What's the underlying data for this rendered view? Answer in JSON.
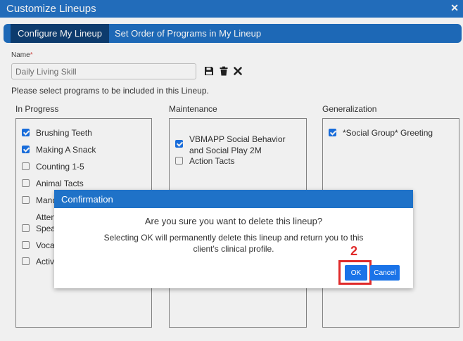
{
  "window": {
    "title": "Customize Lineups",
    "close_glyph": "✕"
  },
  "tabs": [
    {
      "label": "Configure My Lineup",
      "active": true
    },
    {
      "label": "Set Order of Programs in My Lineup",
      "active": false
    }
  ],
  "name_field": {
    "label": "Name",
    "required_mark": "*",
    "value": "Daily Living Skill"
  },
  "toolbar_icons": [
    "save-icon",
    "trash-icon",
    "close-icon"
  ],
  "instruction": "Please select programs to be included in this Lineup.",
  "columns": {
    "in_progress": {
      "header": "In Progress",
      "items": [
        {
          "label": "Brushing Teeth",
          "checked": true
        },
        {
          "label": "Making A Snack",
          "checked": true
        },
        {
          "label": "Counting 1-5",
          "checked": false
        },
        {
          "label": "Animal Tacts",
          "checked": false
        },
        {
          "label": "Mand",
          "checked": false
        },
        {
          "label": "Atten",
          "checked": false
        },
        {
          "label": "Speal",
          "checked": false
        },
        {
          "label": "Vocal",
          "checked": false
        },
        {
          "label": "Activi",
          "checked": false
        }
      ]
    },
    "maintenance": {
      "header": "Maintenance",
      "items": [
        {
          "label": "VBMAPP Social Behavior and Social Play 2M",
          "checked": true
        },
        {
          "label": "Action Tacts",
          "checked": false
        }
      ]
    },
    "generalization": {
      "header": "Generalization",
      "items": [
        {
          "label": "*Social Group* Greeting",
          "checked": true
        }
      ]
    }
  },
  "dialog": {
    "title": "Confirmation",
    "question": "Are you sure you want to delete this lineup?",
    "message": "Selecting OK will permanently delete this lineup and return you to this client's clinical profile.",
    "ok_label": "OK",
    "cancel_label": "Cancel"
  },
  "annotation": {
    "step_number": "2",
    "color": "#e02a2a"
  },
  "colors": {
    "primary": "#1f72c8",
    "tab_active": "#0e3f74",
    "button": "#1a73e8"
  }
}
